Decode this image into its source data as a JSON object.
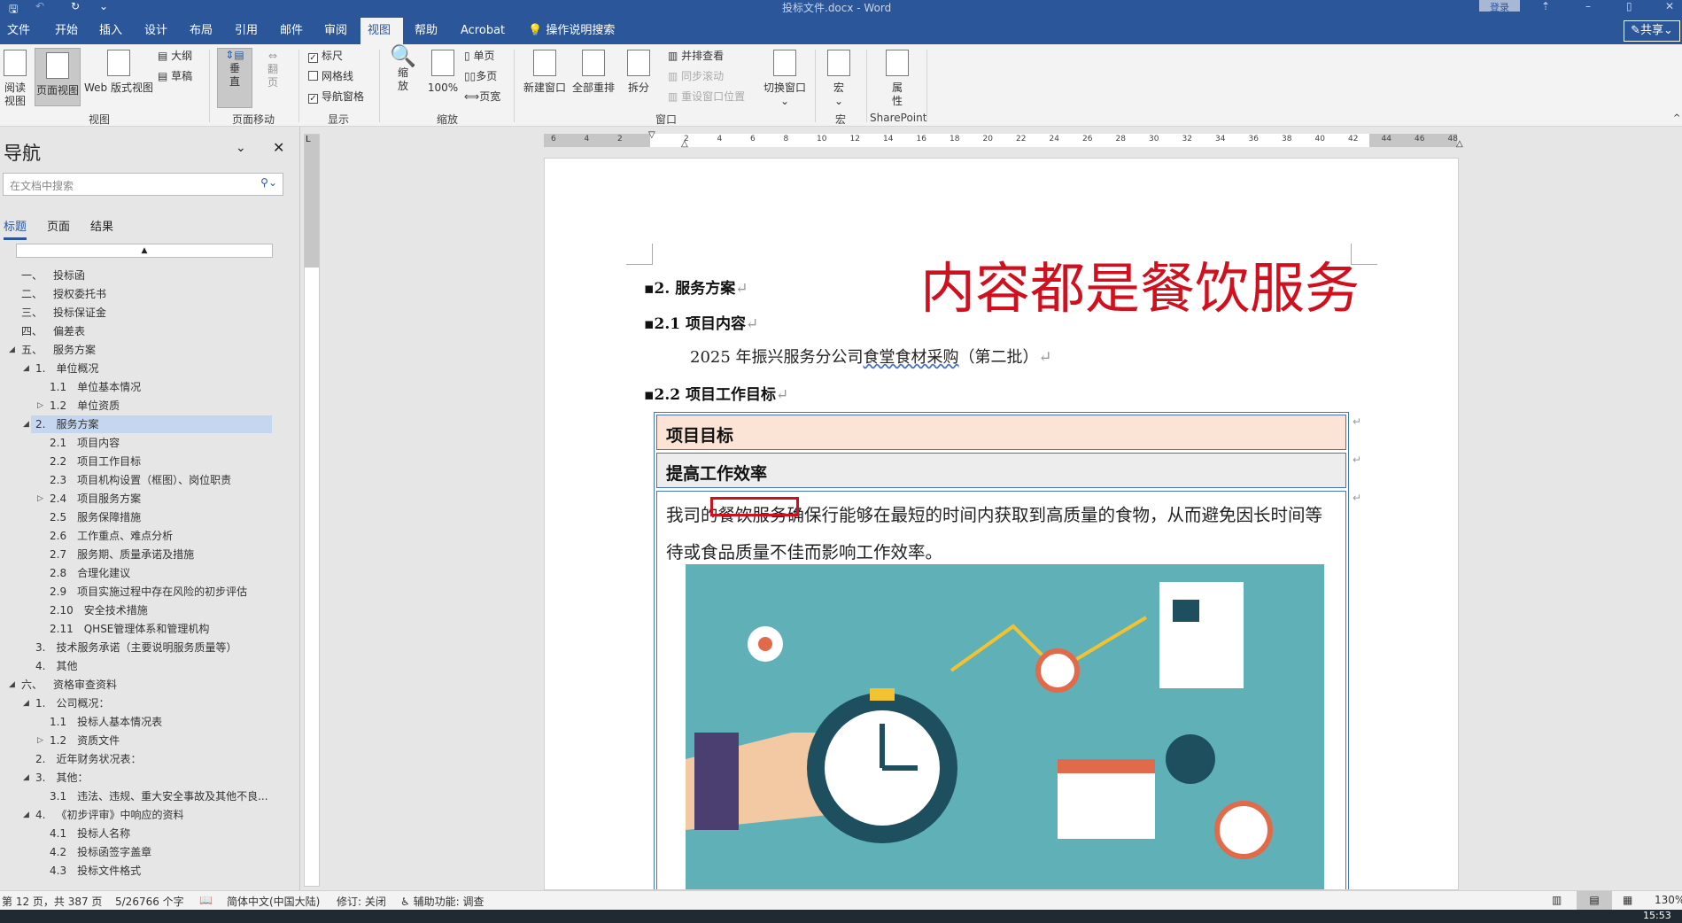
{
  "window": {
    "title": "投标文件.docx  -  Word",
    "login": "登录",
    "share": "共享"
  },
  "tabs": [
    "文件",
    "开始",
    "插入",
    "设计",
    "布局",
    "引用",
    "邮件",
    "审阅",
    "视图",
    "帮助",
    "Acrobat"
  ],
  "active_tab": "视图",
  "tell_me": "操作说明搜索",
  "ribbon": {
    "view": {
      "read": "阅读\n视图",
      "print": "页面视图",
      "web": "Web 版式视图",
      "outline": "大纲",
      "draft": "草稿",
      "label": "视图"
    },
    "page_move": {
      "vertical": "垂\n直",
      "side": "翻\n页",
      "label": "页面移动"
    },
    "show": {
      "ruler": "标尺",
      "gridlines": "网格线",
      "nav_pane": "导航窗格",
      "ruler_checked": true,
      "grid_checked": false,
      "nav_checked": true,
      "label": "显示"
    },
    "zoom": {
      "zoom": "缩\n放",
      "hundred": "100%",
      "one_page": "单页",
      "multi_page": "多页",
      "page_width": "页宽",
      "label": "缩放"
    },
    "window": {
      "new": "新建窗口",
      "arrange": "全部重排",
      "split": "拆分",
      "side_by_side": "并排查看",
      "sync": "同步滚动",
      "reset": "重设窗口位置",
      "switch": "切换窗口",
      "label": "窗口"
    },
    "macros": {
      "macro": "宏",
      "label": "宏"
    },
    "sharepoint": {
      "props": "属\n性",
      "label": "SharePoint"
    }
  },
  "nav": {
    "title": "导航",
    "search_placeholder": "在文档中搜索",
    "tabs": [
      "标题",
      "页面",
      "结果"
    ],
    "items": [
      {
        "num": "一、",
        "text": "投标函",
        "level": 0,
        "toggle": ""
      },
      {
        "num": "二、",
        "text": "授权委托书",
        "level": 0,
        "toggle": ""
      },
      {
        "num": "三、",
        "text": "投标保证金",
        "level": 0,
        "toggle": ""
      },
      {
        "num": "四、",
        "text": "偏差表",
        "level": 0,
        "toggle": ""
      },
      {
        "num": "五、",
        "text": "服务方案",
        "level": 0,
        "toggle": "open"
      },
      {
        "num": "1.",
        "text": "单位概况",
        "level": 1,
        "toggle": "open"
      },
      {
        "num": "1.1",
        "text": "单位基本情况",
        "level": 2,
        "toggle": ""
      },
      {
        "num": "1.2",
        "text": "单位资质",
        "level": 2,
        "toggle": "closed"
      },
      {
        "num": "2.",
        "text": "服务方案",
        "level": 1,
        "toggle": "open",
        "selected": true
      },
      {
        "num": "2.1",
        "text": "项目内容",
        "level": 2,
        "toggle": ""
      },
      {
        "num": "2.2",
        "text": "项目工作目标",
        "level": 2,
        "toggle": ""
      },
      {
        "num": "2.3",
        "text": "项目机构设置（框图）、岗位职责",
        "level": 2,
        "toggle": ""
      },
      {
        "num": "2.4",
        "text": "项目服务方案",
        "level": 2,
        "toggle": "closed"
      },
      {
        "num": "2.5",
        "text": "服务保障措施",
        "level": 2,
        "toggle": ""
      },
      {
        "num": "2.6",
        "text": "工作重点、难点分析",
        "level": 2,
        "toggle": ""
      },
      {
        "num": "2.7",
        "text": "服务期、质量承诺及措施",
        "level": 2,
        "toggle": ""
      },
      {
        "num": "2.8",
        "text": "合理化建议",
        "level": 2,
        "toggle": ""
      },
      {
        "num": "2.9",
        "text": "项目实施过程中存在风险的初步评估",
        "level": 2,
        "toggle": ""
      },
      {
        "num": "2.10",
        "text": "安全技术措施",
        "level": 2,
        "toggle": ""
      },
      {
        "num": "2.11",
        "text": "QHSE管理体系和管理机构",
        "level": 2,
        "toggle": ""
      },
      {
        "num": "3.",
        "text": "技术服务承诺（主要说明服务质量等）",
        "level": 1,
        "toggle": ""
      },
      {
        "num": "4.",
        "text": "其他",
        "level": 1,
        "toggle": ""
      },
      {
        "num": "六、",
        "text": "资格审查资料",
        "level": 0,
        "toggle": "open"
      },
      {
        "num": "1.",
        "text": "公司概况：",
        "level": 1,
        "toggle": "open"
      },
      {
        "num": "1.1",
        "text": "投标人基本情况表",
        "level": 2,
        "toggle": ""
      },
      {
        "num": "1.2",
        "text": "资质文件",
        "level": 2,
        "toggle": "closed"
      },
      {
        "num": "2.",
        "text": "近年财务状况表：",
        "level": 1,
        "toggle": ""
      },
      {
        "num": "3.",
        "text": "其他：",
        "level": 1,
        "toggle": "open"
      },
      {
        "num": "3.1",
        "text": "违法、违规、重大安全事故及其他不良...",
        "level": 2,
        "toggle": ""
      },
      {
        "num": "4.",
        "text": "《初步评审》中响应的资料",
        "level": 1,
        "toggle": "open"
      },
      {
        "num": "4.1",
        "text": "投标人名称",
        "level": 2,
        "toggle": ""
      },
      {
        "num": "4.2",
        "text": "投标函签字盖章",
        "level": 2,
        "toggle": ""
      },
      {
        "num": "4.3",
        "text": "投标文件格式",
        "level": 2,
        "toggle": ""
      }
    ]
  },
  "ruler": {
    "ticks": [
      "6",
      "4",
      "2",
      "",
      "2",
      "4",
      "6",
      "8",
      "10",
      "12",
      "14",
      "16",
      "18",
      "20",
      "22",
      "24",
      "26",
      "28",
      "30",
      "32",
      "34",
      "36",
      "38",
      "40",
      "42",
      "44",
      "46",
      "48"
    ]
  },
  "document": {
    "overlay": "内容都是餐饮服务",
    "h2": "2. 服务方案",
    "h21": "2.1  项目内容",
    "p21_a": "2025 年振兴服务分公司",
    "p21_b": "食堂食材采购",
    "p21_c": "（第二批）",
    "h22": "2.2  项目工作目标",
    "table": {
      "row1": "项目目标",
      "row2": "提高工作效率",
      "row3": "我司的餐饮服务确保行能够在最短的时间内获取到高质量的食物，从而避免因长时间等待或食品质量不佳而影响工作效率。"
    },
    "para_mark": "↵"
  },
  "status": {
    "page": "第 12 页，共 387 页",
    "words": "5/26766 个字",
    "lang": "简体中文(中国大陆)",
    "track": "修订: 关闭",
    "access": "辅助功能: 调查",
    "zoom": "130%"
  },
  "taskbar": {
    "time": "15:53"
  },
  "colors": {
    "brand": "#2b579a",
    "overlay": "#d0101e",
    "row1": "#fbe4d5",
    "row2": "#ededed",
    "table_border": "#4472c4"
  }
}
